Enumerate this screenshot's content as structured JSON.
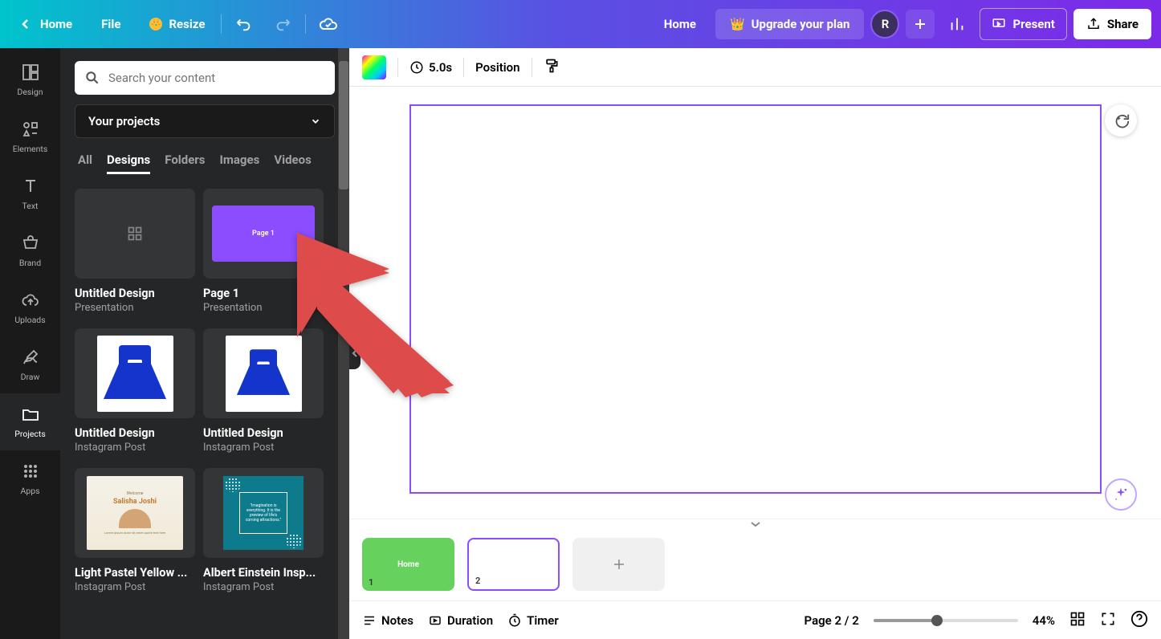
{
  "topbar": {
    "back_home": "Home",
    "file": "File",
    "resize": "Resize",
    "home2": "Home",
    "upgrade": "Upgrade your plan",
    "avatar_letter": "R",
    "present": "Present",
    "share": "Share"
  },
  "leftrail": {
    "design": "Design",
    "elements": "Elements",
    "text": "Text",
    "brand": "Brand",
    "uploads": "Uploads",
    "draw": "Draw",
    "projects": "Projects",
    "apps": "Apps"
  },
  "panel": {
    "search_placeholder": "Search your content",
    "dropdown": "Your projects",
    "tabs": {
      "all": "All",
      "designs": "Designs",
      "folders": "Folders",
      "images": "Images",
      "videos": "Videos"
    },
    "cards": [
      {
        "title": "Untitled Design",
        "sub": "Presentation"
      },
      {
        "title": "Page 1",
        "sub": "Presentation",
        "thumb_text": "Page 1"
      },
      {
        "title": "Untitled Design",
        "sub": "Instagram Post"
      },
      {
        "title": "Untitled Design",
        "sub": "Instagram Post"
      },
      {
        "title": "Light Pastel Yellow ...",
        "sub": "Instagram Post",
        "pastel_name": "Salisha Joshi"
      },
      {
        "title": "Albert Einstein Insp...",
        "sub": "Instagram Post",
        "quote": "\"Imagination is everything. It is the preview of life's coming attractions.\""
      }
    ]
  },
  "canvas_toolbar": {
    "duration": "5.0s",
    "position": "Position"
  },
  "page_strip": {
    "p1_label": "Home",
    "p1_num": "1",
    "p2_num": "2"
  },
  "bottombar": {
    "notes": "Notes",
    "duration": "Duration",
    "timer": "Timer",
    "page_count": "Page 2 / 2",
    "zoom": "44%"
  }
}
